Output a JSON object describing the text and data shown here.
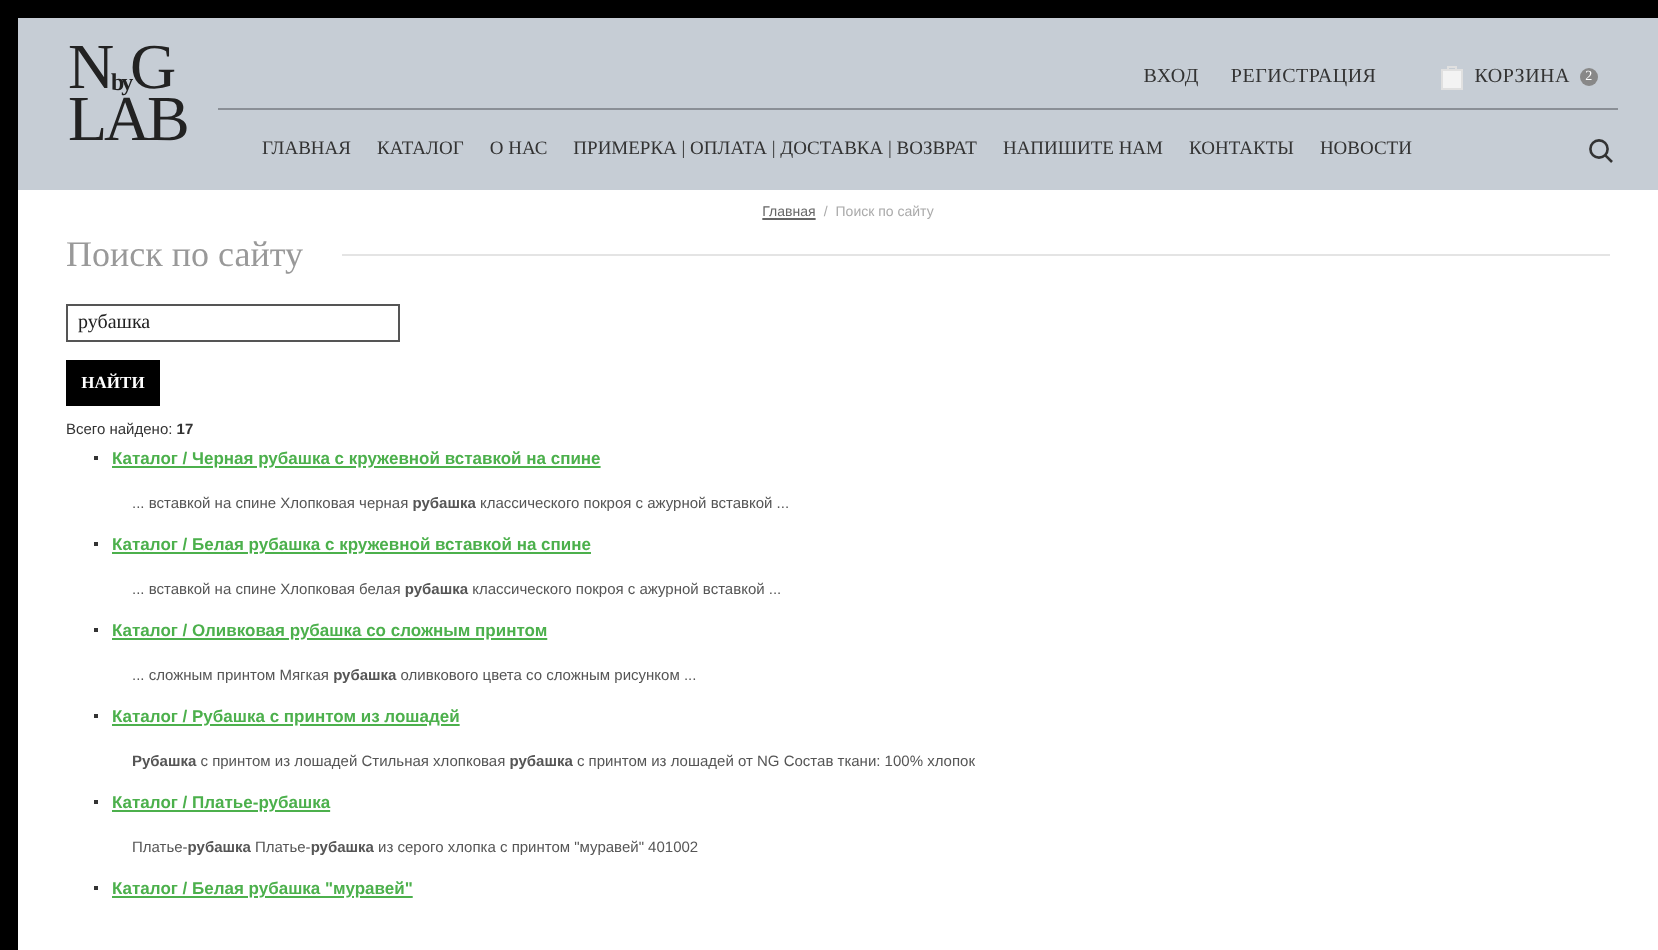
{
  "logo": {
    "top_left": "N",
    "top_small": "by",
    "top_right": "G",
    "bottom": "LAB"
  },
  "top_links": [
    {
      "label": "ВХОД"
    },
    {
      "label": "РЕГИСТРАЦИЯ"
    }
  ],
  "cart": {
    "label": "КОРЗИНА",
    "count": "2"
  },
  "nav": [
    "ГЛАВНАЯ",
    "КАТАЛОГ",
    "О НАС",
    "ПРИМЕРКА | ОПЛАТА | ДОСТАВКА | ВОЗВРАТ",
    "НАПИШИТЕ НАМ",
    "КОНТАКТЫ",
    "НОВОСТИ"
  ],
  "breadcrumb": {
    "link": "Главная",
    "separator": "/",
    "current": "Поиск по сайту"
  },
  "title": "Поиск по сайту",
  "search": {
    "value": "рубашка",
    "button": "НАЙТИ"
  },
  "total": "Всего найдено: **17**",
  "results": [
    {
      "title": "Каталог / Черная рубашка с кружевной вставкой на спине",
      "snippet": "... вставкой на спине Хлопковая черная **рубашка** классического покроя с ажурной вставкой ..."
    },
    {
      "title": "Каталог / Белая рубашка с кружевной вставкой на спине",
      "snippet": "... вставкой на спине Хлопковая белая **рубашка** классического покроя с ажурной вставкой ..."
    },
    {
      "title": "Каталог / Оливковая рубашка со сложным принтом",
      "snippet": "... сложным принтом Мягкая **рубашка** оливкового цвета со сложным рисунком ..."
    },
    {
      "title": "Каталог / Рубашка с принтом из лошадей",
      "snippet": "**Рубашка** с принтом из лошадей Стильная хлопковая **рубашка** с принтом из лошадей от NG Состав ткани: 100% хлопок"
    },
    {
      "title": "Каталог / Платье-рубашка",
      "snippet": "Платье-**рубашка** Платье-**рубашка** из серого хлопка с принтом \"муравей\" 401002"
    },
    {
      "title": "Каталог / Белая рубашка \"муравей\""
    }
  ]
}
